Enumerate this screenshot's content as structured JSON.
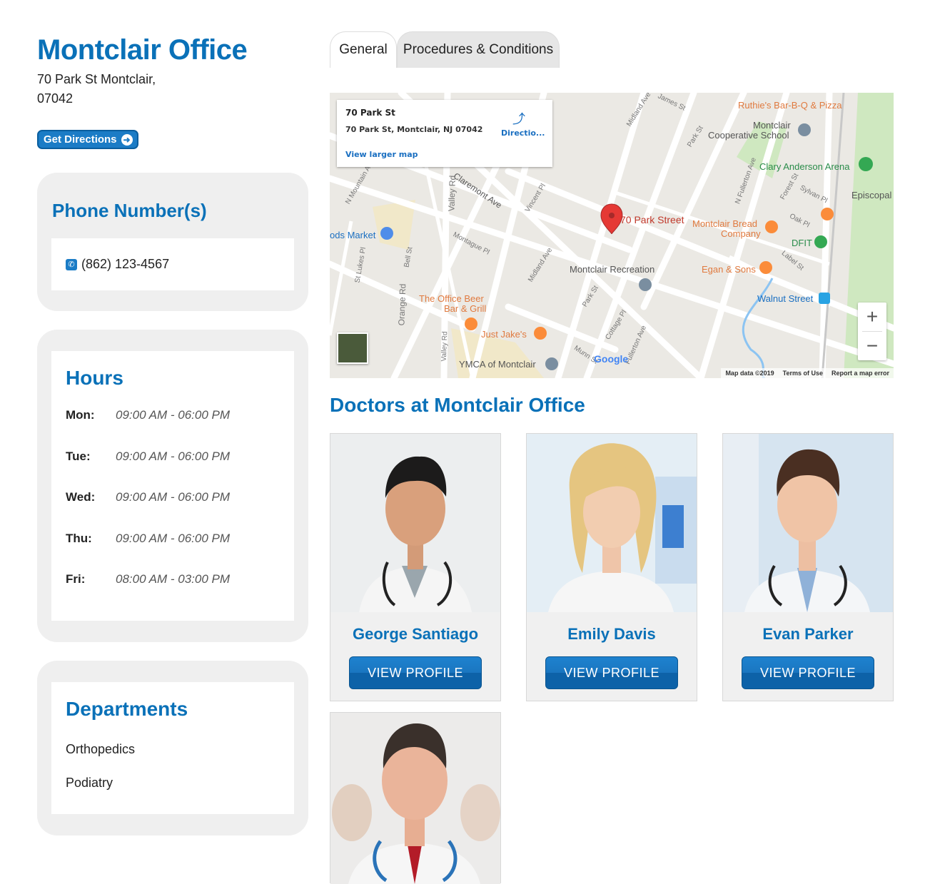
{
  "office": {
    "title": "Montclair Office",
    "address_line1": "70 Park St Montclair,",
    "address_line2": "07042",
    "directions_label": "Get Directions"
  },
  "phone": {
    "heading": "Phone Number(s)",
    "number": "(862) 123-4567"
  },
  "hours": {
    "heading": "Hours",
    "rows": [
      {
        "day": "Mon:",
        "time": "09:00 AM - 06:00 PM"
      },
      {
        "day": "Tue:",
        "time": "09:00 AM - 06:00 PM"
      },
      {
        "day": "Wed:",
        "time": "09:00 AM - 06:00 PM"
      },
      {
        "day": "Thu:",
        "time": "09:00 AM - 06:00 PM"
      },
      {
        "day": "Fri:",
        "time": "08:00 AM - 03:00 PM"
      }
    ]
  },
  "departments": {
    "heading": "Departments",
    "items": [
      "Orthopedics",
      "Podiatry"
    ]
  },
  "tabs": [
    {
      "label": "General",
      "active": true
    },
    {
      "label": "Procedures & Conditions",
      "active": false
    }
  ],
  "map": {
    "info_title": "70 Park St",
    "info_address": "70 Park St, Montclair, NJ 07042",
    "view_larger": "View larger map",
    "directions": "Directio...",
    "pin_label": "70 Park Street",
    "labels": {
      "ruthies": "Ruthie's Bar-B-Q & Pizza",
      "coop1": "Montclair",
      "coop2": "Cooperative School",
      "clary": "Clary Anderson Arena",
      "bread1": "Montclair Bread",
      "bread2": "Company",
      "dfit": "DFIT",
      "recreation": "Montclair Recreation",
      "egan": "Egan & Sons",
      "walnut": "Walnut Street",
      "officebeer1": "The Office Beer",
      "officebeer2": "Bar & Grill",
      "justjakes": "Just Jake's",
      "ymca": "YMCA of Montclair",
      "market": "ods Market",
      "episcopal": "Episcopal",
      "claremont": "Claremont Ave",
      "valley": "Valley Rd",
      "orange": "Orange Rd",
      "stlukes": "St Lukes Pl",
      "bell": "Bell St",
      "montague": "Montague Pl",
      "midland": "Midland Ave",
      "midland2": "Midland Ave",
      "vincent": "Vincent Pl",
      "park": "Park St",
      "park2": "Park St",
      "cottage": "Cottage Pl",
      "fullerton": "N Fullerton Ave",
      "fullerton2": "Fullerton Ave",
      "forest": "Forest St",
      "sylvan": "Sylvan Pl",
      "oak": "Oak Pl",
      "label": "Label St",
      "james": "James St",
      "munn": "Munn St",
      "nmountain": "N Mountain A",
      "valley2": "Valley Rd"
    },
    "google": "Google",
    "footer": [
      "Map data ©2019",
      "Terms of Use",
      "Report a map error"
    ]
  },
  "doctors": {
    "heading": "Doctors at Montclair Office",
    "view_profile": "VIEW PROFILE",
    "list": [
      {
        "name": "George Santiago"
      },
      {
        "name": "Emily Davis"
      },
      {
        "name": "Evan Parker"
      },
      {
        "name": ""
      }
    ]
  }
}
